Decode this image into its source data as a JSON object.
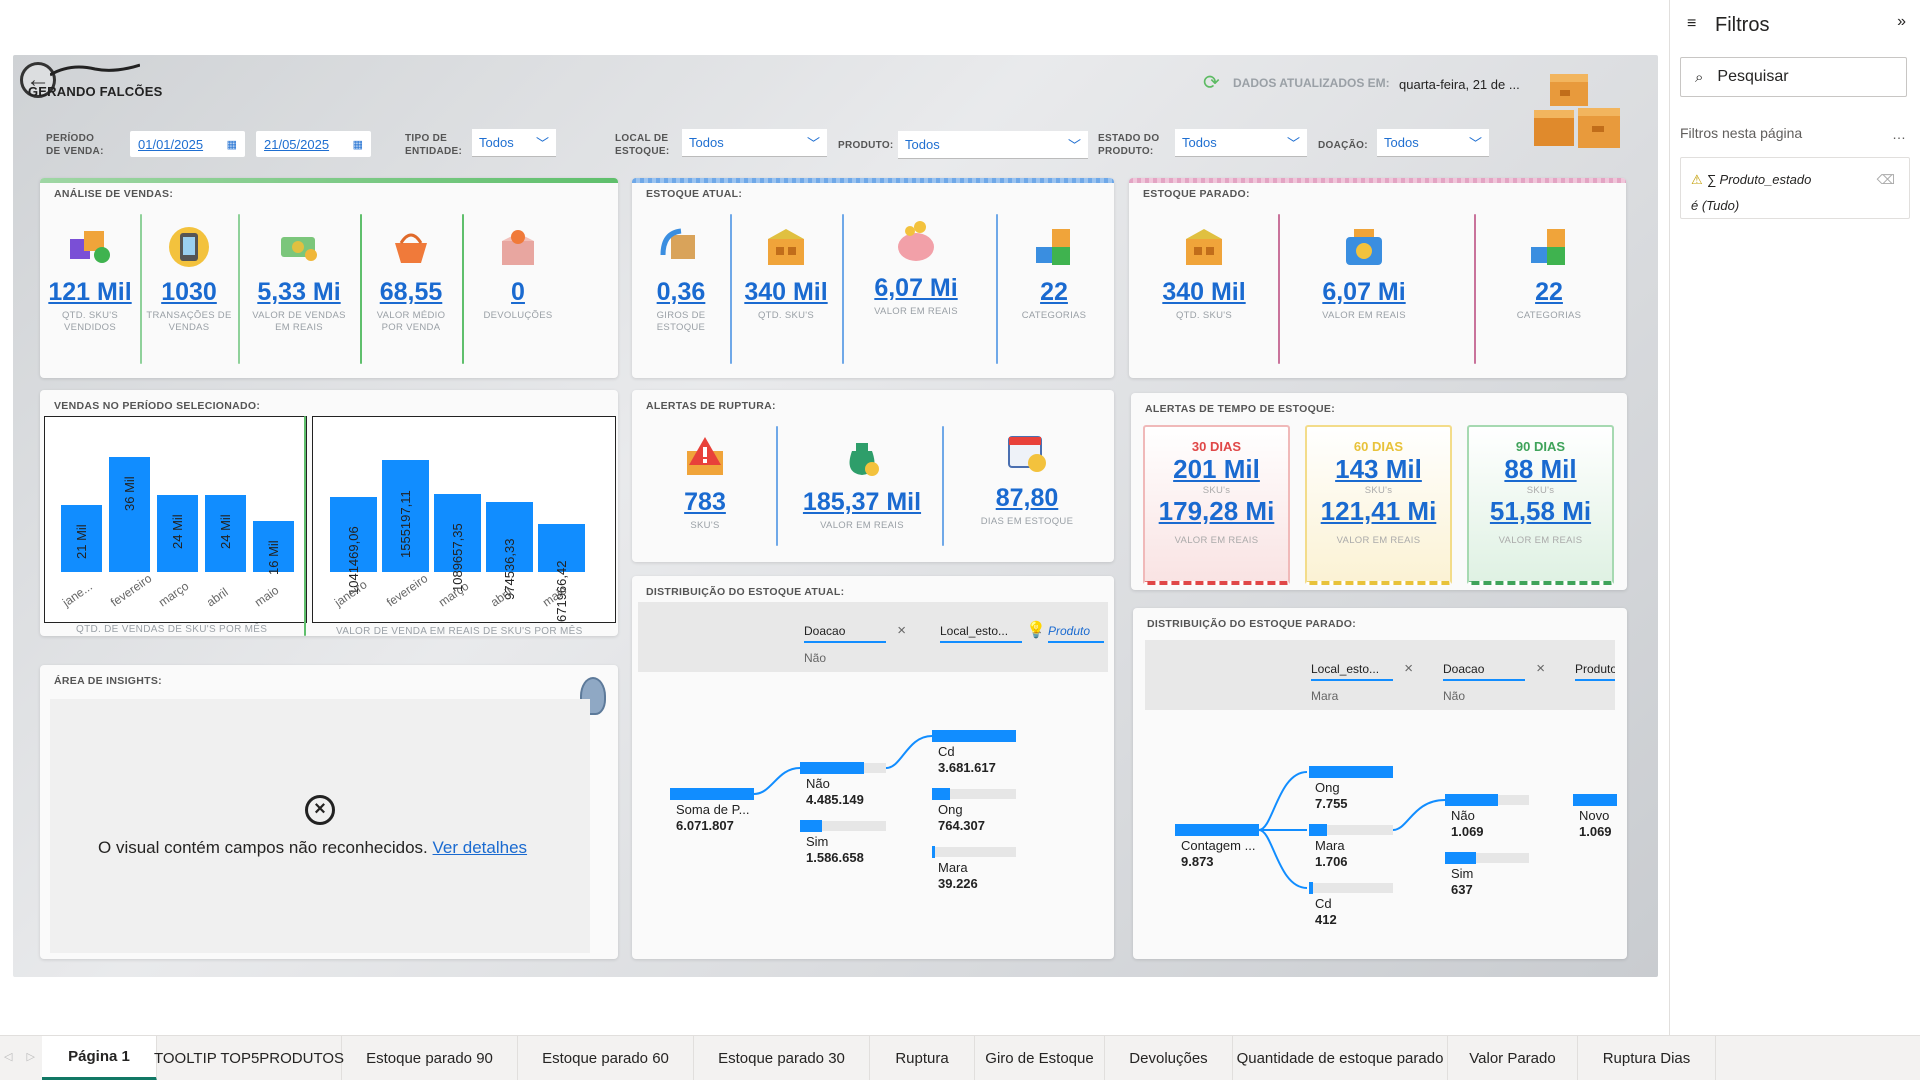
{
  "header": {
    "logo_text": "GERANDO FALCÕES",
    "updated_label": "DADOS ATUALIZADOS EM:",
    "updated_value": "quarta-feira, 21 de ..."
  },
  "slicers": {
    "periodo_label": "PERÍODO\nDE VENDA:",
    "date_start": "01/01/2025",
    "date_end": "21/05/2025",
    "tipo_label": "TIPO DE\nENTIDADE:",
    "tipo_value": "Todos",
    "local_label": "LOCAL DE\nESTOQUE:",
    "local_value": "Todos",
    "produto_label": "PRODUTO:",
    "produto_value": "Todos",
    "estado_label": "ESTADO DO\nPRODUTO:",
    "estado_value": "Todos",
    "doacao_label": "DOAÇÃO:",
    "doacao_value": "Todos"
  },
  "analise": {
    "title": "ANÁLISE DE VENDAS:",
    "kpis": [
      {
        "value": "121 Mil",
        "label": "QTD. SKU'S VENDIDOS",
        "icon": "cubes-icon"
      },
      {
        "value": "1030",
        "label": "TRANSAÇÕES DE VENDAS",
        "icon": "phone-transaction-icon"
      },
      {
        "value": "5,33 Mi",
        "label": "VALOR DE VENDAS EM REAIS",
        "icon": "money-icon"
      },
      {
        "value": "68,55",
        "label": "VALOR MÉDIO POR VENDA",
        "icon": "basket-icon"
      },
      {
        "value": "0",
        "label": "DEVOLUÇÕES",
        "icon": "return-box-icon"
      }
    ]
  },
  "estoque_atual": {
    "title": "ESTOQUE ATUAL:",
    "kpis": [
      {
        "value": "0,36",
        "label": "GIROS DE ESTOQUE",
        "icon": "rotate-box-icon"
      },
      {
        "value": "340 Mil",
        "label": "QTD. SKU's",
        "icon": "warehouse-icon"
      },
      {
        "value": "6,07 Mi",
        "label": "VALOR EM REAIS",
        "icon": "piggy-bank-icon"
      },
      {
        "value": "22",
        "label": "CATEGORIAS",
        "icon": "categories-icon"
      }
    ]
  },
  "estoque_parado": {
    "title": "ESTOQUE PARADO:",
    "kpis": [
      {
        "value": "340 Mil",
        "label": "QTD. SKU's",
        "icon": "warehouse-icon"
      },
      {
        "value": "6,07 Mi",
        "label": "VALOR EM REAIS",
        "icon": "money-box-icon"
      },
      {
        "value": "22",
        "label": "CATEGORIAS",
        "icon": "categories-icon"
      }
    ]
  },
  "vendas_periodo": {
    "title": "VENDAS NO PERÍODO SELECIONADO:",
    "caption_qtd": "QTD. DE VENDAS DE SKU'S POR MÊS",
    "caption_valor": "VALOR DE VENDA EM REAIS DE SKU'S POR MÊS"
  },
  "chart_data": [
    {
      "type": "bar",
      "title": "",
      "xlabel": "QTD. DE VENDAS DE SKU'S POR MÊS",
      "ylabel": "",
      "categories": [
        "jane...",
        "fevereiro",
        "março",
        "abril",
        "maio"
      ],
      "values": [
        21000,
        36000,
        24000,
        24000,
        16000
      ],
      "data_labels": [
        "21 Mil",
        "36 Mil",
        "24 Mil",
        "24 Mil",
        "16 Mil"
      ],
      "ylim": [
        0,
        36000
      ]
    },
    {
      "type": "bar",
      "title": "",
      "xlabel": "VALOR DE VENDA EM REAIS DE SKU'S POR MÊS",
      "ylabel": "",
      "categories": [
        "janeiro",
        "fevereiro",
        "março",
        "abril",
        "maio"
      ],
      "values": [
        1041469.06,
        1555197.11,
        1089657.35,
        974536.33,
        671966.42
      ],
      "data_labels": [
        "1041469,06",
        "1555197,11",
        "1089657,35",
        "974536,33",
        "671966,42"
      ],
      "ylim": [
        0,
        1555197.11
      ]
    }
  ],
  "ruptura": {
    "title": "ALERTAS DE RUPTURA:",
    "kpis": [
      {
        "value": "783",
        "label": "SKU's",
        "icon": "warning-box-icon"
      },
      {
        "value": "185,37 Mil",
        "label": "VALOR EM REAIS",
        "icon": "money-bag-icon"
      },
      {
        "value": "87,80",
        "label": "DIAS EM ESTOQUE",
        "icon": "calendar-clock-icon"
      }
    ]
  },
  "tempo_estoque": {
    "title": "ALERTAS DE TEMPO DE ESTOQUE:",
    "boxes": [
      {
        "title": "30 DIAS",
        "v1": "201 Mil",
        "s1": "SKU's",
        "v2": "179,28 Mi",
        "s2": "VALOR EM REAIS",
        "color": "#e04848"
      },
      {
        "title": "60 DIAS",
        "v1": "143 Mil",
        "s1": "SKU's",
        "v2": "121,41 Mi",
        "s2": "VALOR EM REAIS",
        "color": "#e8c23a"
      },
      {
        "title": "90 DIAS",
        "v1": "88 Mil",
        "s1": "SKU's",
        "v2": "51,58 Mi",
        "s2": "VALOR EM REAIS",
        "color": "#3fa35a"
      }
    ]
  },
  "insights": {
    "title": "ÁREA DE INSIGHTS:",
    "message": "O visual contém campos não reconhecidos.",
    "link": "Ver detalhes"
  },
  "dist_atual": {
    "title": "DISTRIBUIÇÃO DO ESTOQUE ATUAL:",
    "fields": [
      {
        "name": "Doacao",
        "value": "Não"
      },
      {
        "name": "Local_esto...",
        "value": ""
      },
      {
        "name": "Produto",
        "value": ""
      }
    ],
    "root": {
      "label": "Soma de P...",
      "value": "6.071.807"
    },
    "level1": [
      {
        "label": "Não",
        "value": "4.485.149",
        "fraction": 0.74
      },
      {
        "label": "Sim",
        "value": "1.586.658",
        "fraction": 0.26
      }
    ],
    "level2": [
      {
        "label": "Cd",
        "value": "3.681.617",
        "fraction": 1.0
      },
      {
        "label": "Ong",
        "value": "764.307",
        "fraction": 0.21
      },
      {
        "label": "Mara",
        "value": "39.226",
        "fraction": 0.02
      }
    ]
  },
  "dist_parado": {
    "title": "DISTRIBUIÇÃO DO ESTOQUE PARADO:",
    "fields": [
      {
        "name": "Local_esto...",
        "value": "Mara"
      },
      {
        "name": "Doacao",
        "value": "Não"
      },
      {
        "name": "Produto",
        "value": ""
      }
    ],
    "root": {
      "label": "Contagem ...",
      "value": "9.873"
    },
    "level1": [
      {
        "label": "Ong",
        "value": "7.755",
        "fraction": 1.0
      },
      {
        "label": "Mara",
        "value": "1.706",
        "fraction": 0.22
      },
      {
        "label": "Cd",
        "value": "412",
        "fraction": 0.05
      }
    ],
    "level2": [
      {
        "label": "Não",
        "value": "1.069",
        "fraction": 0.63
      },
      {
        "label": "Sim",
        "value": "637",
        "fraction": 0.37
      }
    ],
    "level3": [
      {
        "label": "Novo",
        "value": "1.069",
        "fraction": 1.0
      }
    ]
  },
  "filters": {
    "title": "Filtros",
    "search_placeholder": "Pesquisar",
    "section": "Filtros nesta página",
    "filter_name": "∑ Produto_estado",
    "filter_value": "é (Tudo)"
  },
  "tabs": [
    "Página 1",
    "TOOLTIP TOP5PRODUTOS",
    "Estoque parado 90",
    "Estoque parado 60",
    "Estoque parado 30",
    "Ruptura",
    "Giro de Estoque",
    "Devoluções",
    "Quantidade de estoque parado",
    "Valor Parado",
    "Ruptura Dias"
  ],
  "colors": {
    "accent": "#118dff",
    "kpi_value": "#1a6ad0",
    "green": "#3fa35a",
    "blue": "#1a6ad0",
    "pink": "#c9739b"
  }
}
